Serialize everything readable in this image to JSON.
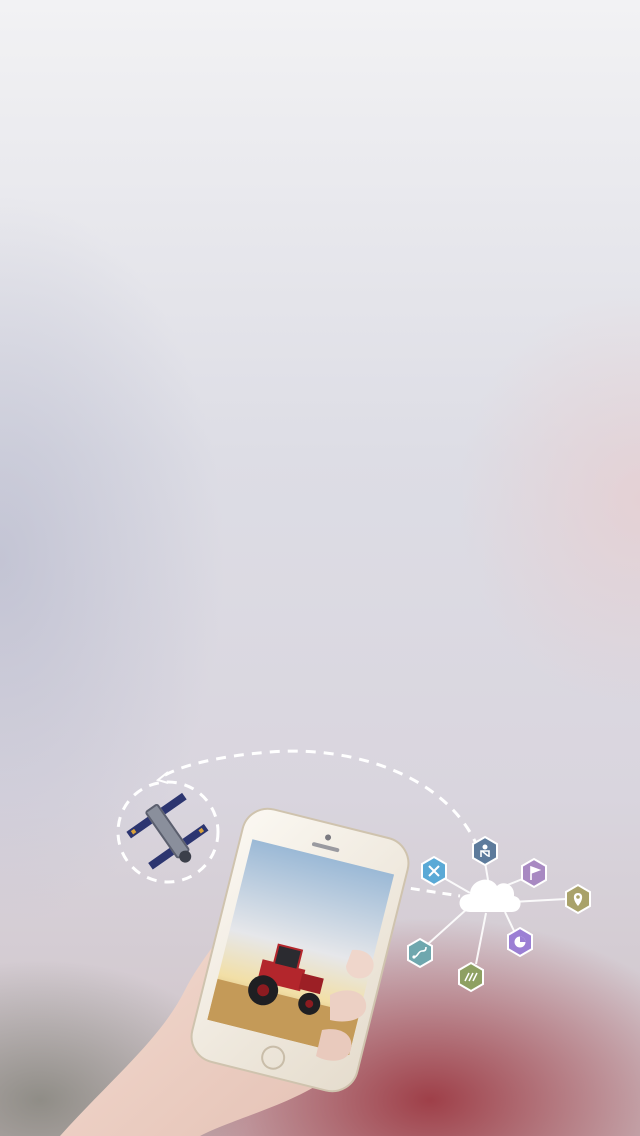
{
  "colors": {
    "hex_blue": "#5aa9d6",
    "hex_slate": "#5d7b9c",
    "hex_purple": "#a889c2",
    "hex_olive": "#a9a26a",
    "hex_violet": "#9b7fd4",
    "hex_green": "#8ea062",
    "hex_teal": "#6fa7ae"
  },
  "icons": {
    "satellite": "satellite-icon",
    "phone": "smartphone-icon",
    "cloud": "cloud-icon",
    "hexagons": [
      "tools-icon",
      "seatbelt-icon",
      "flag-icon",
      "location-pin-icon",
      "pie-chart-icon",
      "field-icon",
      "route-icon"
    ]
  }
}
